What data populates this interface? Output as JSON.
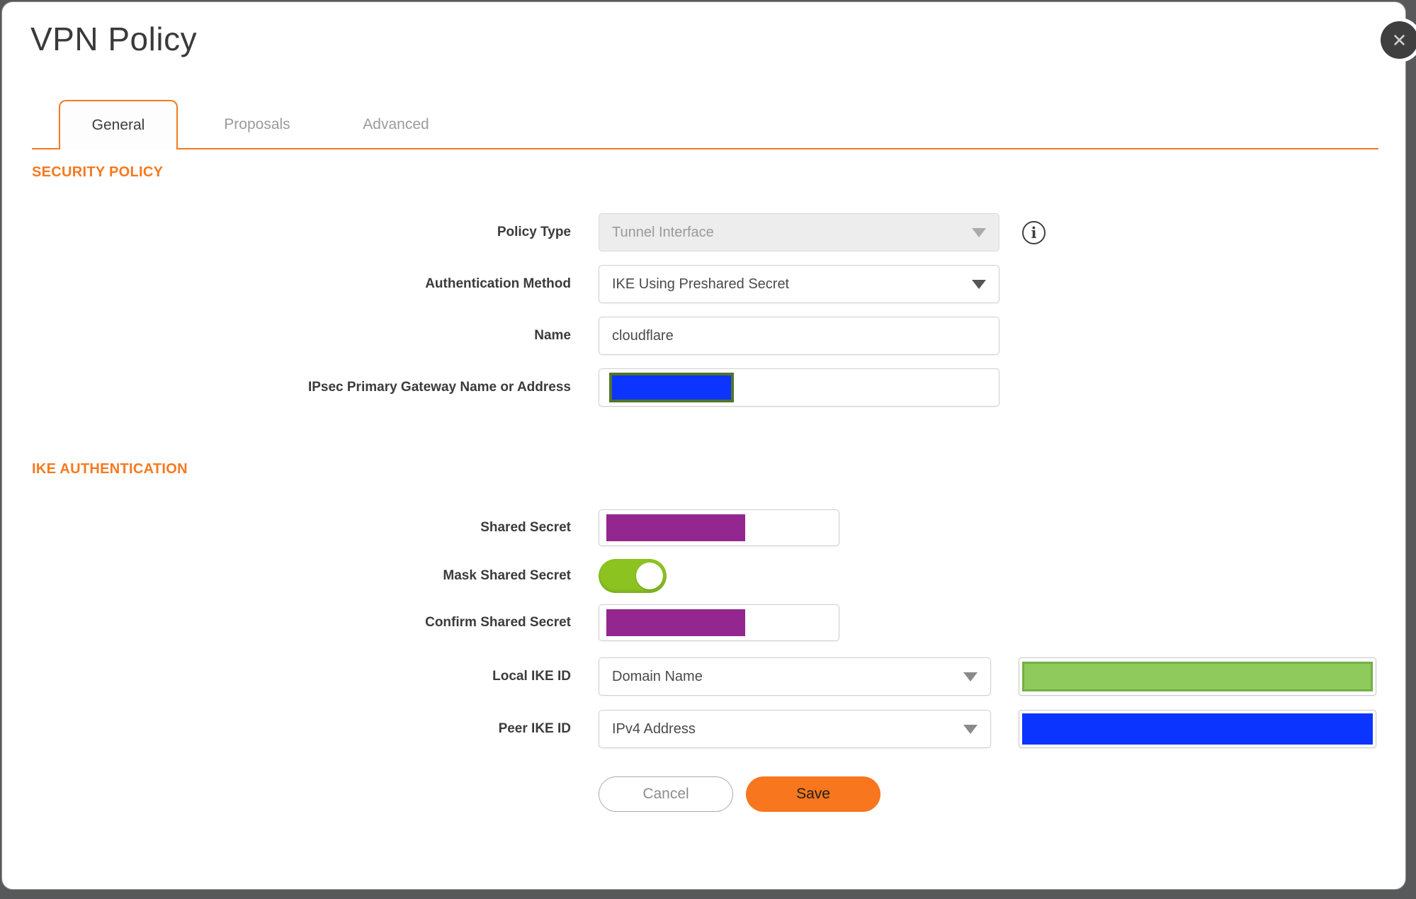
{
  "dialog": {
    "title": "VPN Policy",
    "close_icon": "✕",
    "info_icon": "i"
  },
  "tabs": [
    {
      "label": "General",
      "active": true
    },
    {
      "label": "Proposals",
      "active": false
    },
    {
      "label": "Advanced",
      "active": false
    }
  ],
  "sections": {
    "security_policy": {
      "title": "SECURITY POLICY"
    },
    "ike_authentication": {
      "title": "IKE AUTHENTICATION"
    }
  },
  "fields": {
    "policy_type": {
      "label": "Policy Type",
      "value": "Tunnel Interface",
      "disabled": true
    },
    "authentication_method": {
      "label": "Authentication Method",
      "value": "IKE Using Preshared Secret"
    },
    "name": {
      "label": "Name",
      "value": "cloudflare"
    },
    "gateway": {
      "label": "IPsec Primary Gateway Name or Address",
      "value_redacted": "blue-box"
    },
    "shared_secret": {
      "label": "Shared Secret",
      "value_redacted": "purple-box"
    },
    "mask_shared_secret": {
      "label": "Mask Shared Secret",
      "state": "on"
    },
    "confirm_shared_secret": {
      "label": "Confirm Shared Secret",
      "value_redacted": "purple-box"
    },
    "local_ike_id": {
      "label": "Local IKE ID",
      "type_value": "Domain Name",
      "value_redacted": "green-box"
    },
    "peer_ike_id": {
      "label": "Peer IKE ID",
      "type_value": "IPv4 Address",
      "value_redacted": "blue-box"
    }
  },
  "buttons": {
    "cancel": "Cancel",
    "save": "Save"
  },
  "colors": {
    "accent_orange": "#F5791F",
    "save_orange": "#F8761D",
    "toggle_green": "#8CC320",
    "redact_purple": "#94268F",
    "redact_blue": "#0B35FF",
    "redact_olive": "#51752A",
    "redact_green": "#8FCB5C",
    "redact_green_border": "#74B043",
    "backdrop_gray": "#58595B"
  }
}
